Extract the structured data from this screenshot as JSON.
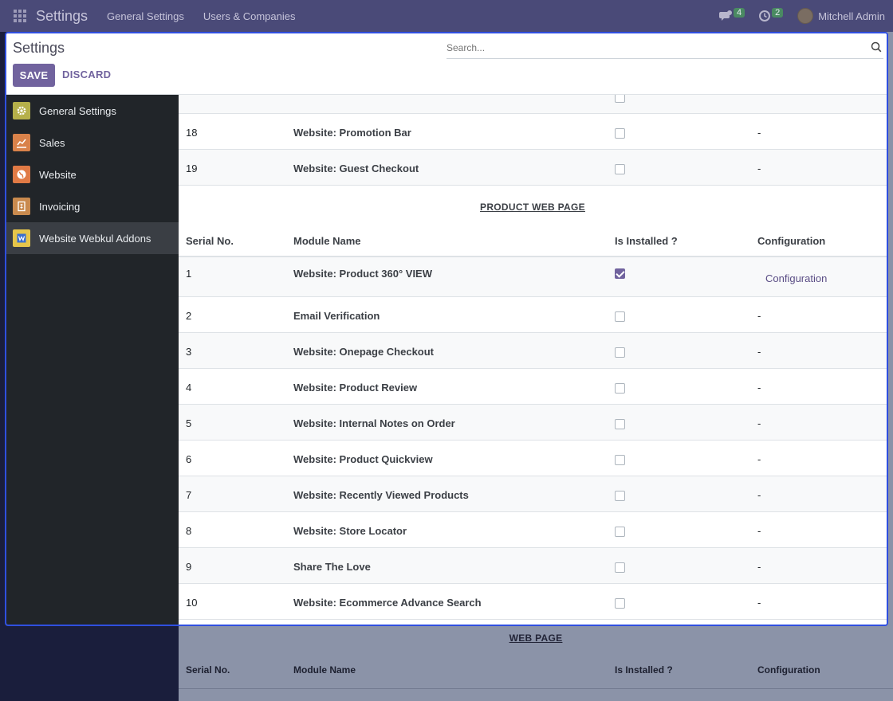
{
  "navbar": {
    "brand": "Settings",
    "menus": [
      "General Settings",
      "Users & Companies"
    ],
    "messages_count": "4",
    "activities_count": "2",
    "user_name": "Mitchell Admin"
  },
  "control_panel": {
    "title": "Settings",
    "search_placeholder": "Search...",
    "save_label": "SAVE",
    "discard_label": "DISCARD"
  },
  "sidebar": {
    "items": [
      {
        "label": "General Settings",
        "icon": "gear-icon",
        "color": "#b5b04a"
      },
      {
        "label": "Sales",
        "icon": "chart-icon",
        "color": "#d9824a"
      },
      {
        "label": "Website",
        "icon": "globe-icon",
        "color": "#e07a45"
      },
      {
        "label": "Invoicing",
        "icon": "invoice-icon",
        "color": "#c98a4e"
      },
      {
        "label": "Website Webkul Addons",
        "icon": "webkul-icon",
        "color": "#e6c64a"
      }
    ]
  },
  "top_rows": [
    {
      "serial": "18",
      "name": "Website: Promotion Bar",
      "config": "-"
    },
    {
      "serial": "19",
      "name": "Website: Guest Checkout",
      "config": "-"
    }
  ],
  "product_section": {
    "title": "PRODUCT WEB PAGE",
    "headers": [
      "Serial No.",
      "Module Name",
      "Is Installed ?",
      "Configuration"
    ],
    "rows": [
      {
        "serial": "1",
        "name": "Website: Product 360° VIEW",
        "installed": true,
        "config": "Configuration"
      },
      {
        "serial": "2",
        "name": "Email Verification",
        "installed": false,
        "config": "-"
      },
      {
        "serial": "3",
        "name": "Website: Onepage Checkout",
        "installed": false,
        "config": "-"
      },
      {
        "serial": "4",
        "name": "Website: Product Review",
        "installed": false,
        "config": "-"
      },
      {
        "serial": "5",
        "name": "Website: Internal Notes on Order",
        "installed": false,
        "config": "-"
      },
      {
        "serial": "6",
        "name": "Website: Product Quickview",
        "installed": false,
        "config": "-"
      },
      {
        "serial": "7",
        "name": "Website: Recently Viewed Products",
        "installed": false,
        "config": "-"
      },
      {
        "serial": "8",
        "name": "Website: Store Locator",
        "installed": false,
        "config": "-"
      },
      {
        "serial": "9",
        "name": "Share The Love",
        "installed": false,
        "config": "-"
      },
      {
        "serial": "10",
        "name": "Website: Ecommerce Advance Search",
        "installed": false,
        "config": "-"
      }
    ]
  },
  "web_section": {
    "title": "WEB PAGE",
    "headers": [
      "Serial No.",
      "Module Name",
      "Is Installed ?",
      "Configuration"
    ]
  },
  "colors": {
    "accent": "#71639e",
    "navbar": "#4a4a78",
    "focus_border": "#2f4fe0"
  }
}
